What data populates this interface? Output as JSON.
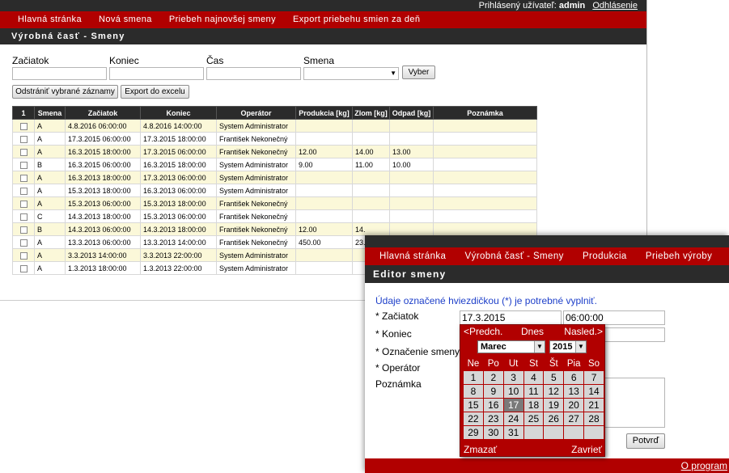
{
  "win1": {
    "user_label": "Prihlásený užívateľ:",
    "user_name": "admin",
    "logout": "Odhlásenie",
    "menu": [
      "Hlavná stránka",
      "Nová smena",
      "Priebeh najnovšej smeny",
      "Export priebehu smien za deň"
    ],
    "title": "Výrobná časť - Smeny",
    "filters": {
      "start_label": "Začiatok",
      "end_label": "Koniec",
      "time_label": "Čas",
      "shift_label": "Smena",
      "select_button": "Vyber"
    },
    "buttons": {
      "delete": "Odstrániť vybrané záznamy",
      "export": "Export do excelu"
    },
    "table": {
      "headers": [
        "1",
        "Smena",
        "Začiatok",
        "Koniec",
        "Operátor",
        "Produkcia [kg]",
        "Zlom [kg]",
        "Odpad [kg]",
        "Poznámka"
      ],
      "rows": [
        [
          "A",
          "4.8.2016 06:00:00",
          "4.8.2016 14:00:00",
          "System Administrator",
          "",
          "",
          "",
          ""
        ],
        [
          "A",
          "17.3.2015 06:00:00",
          "17.3.2015 18:00:00",
          "František Nekonečný",
          "",
          "",
          "",
          ""
        ],
        [
          "A",
          "16.3.2015 18:00:00",
          "17.3.2015 06:00:00",
          "František Nekonečný",
          "12.00",
          "14.00",
          "13.00",
          ""
        ],
        [
          "B",
          "16.3.2015 06:00:00",
          "16.3.2015 18:00:00",
          "System Administrator",
          "9.00",
          "11.00",
          "10.00",
          ""
        ],
        [
          "A",
          "16.3.2013 18:00:00",
          "17.3.2013 06:00:00",
          "System Administrator",
          "",
          "",
          "",
          ""
        ],
        [
          "A",
          "15.3.2013 18:00:00",
          "16.3.2013 06:00:00",
          "System Administrator",
          "",
          "",
          "",
          ""
        ],
        [
          "A",
          "15.3.2013 06:00:00",
          "15.3.2013 18:00:00",
          "František Nekonečný",
          "",
          "",
          "",
          ""
        ],
        [
          "C",
          "14.3.2013 18:00:00",
          "15.3.2013 06:00:00",
          "František Nekonečný",
          "",
          "",
          "",
          ""
        ],
        [
          "B",
          "14.3.2013 06:00:00",
          "14.3.2013 18:00:00",
          "František Nekonečný",
          "12.00",
          "14.",
          "",
          ""
        ],
        [
          "A",
          "13.3.2013 06:00:00",
          "13.3.2013 14:00:00",
          "František Nekonečný",
          "450.00",
          "23.",
          "",
          ""
        ],
        [
          "A",
          "3.3.2013 14:00:00",
          "3.3.2013 22:00:00",
          "System Administrator",
          "",
          "",
          "",
          ""
        ],
        [
          "A",
          "1.3.2013 18:00:00",
          "1.3.2013 22:00:00",
          "System Administrator",
          "",
          "",
          "",
          ""
        ]
      ]
    }
  },
  "win2": {
    "menu": [
      "Hlavná stránka",
      "Výrobná časť - Smeny",
      "Produkcia",
      "Priebeh výroby"
    ],
    "title": "Editor smeny",
    "required_note": "Údaje označené hviezdičkou (*) je potrebné vyplniť.",
    "labels": {
      "start": "* Začiatok",
      "end": "* Koniec",
      "shift": "* Označenie smeny",
      "operator": "* Operátor",
      "note": "Poznámka"
    },
    "start_date_value": "17.3.2015",
    "start_time_value": "06:00:00",
    "confirm_button": "Potvrď",
    "footer_link": "O program"
  },
  "calendar": {
    "prev": "<Predch.",
    "today": "Dnes",
    "next": "Nasled.>",
    "month": "Marec",
    "year": "2015",
    "weekdays": [
      "Ne",
      "Po",
      "Ut",
      "St",
      "Št",
      "Pia",
      "So"
    ],
    "weeks": [
      [
        "1",
        "2",
        "3",
        "4",
        "5",
        "6",
        "7"
      ],
      [
        "8",
        "9",
        "10",
        "11",
        "12",
        "13",
        "14"
      ],
      [
        "15",
        "16",
        "17",
        "18",
        "19",
        "20",
        "21"
      ],
      [
        "22",
        "23",
        "24",
        "25",
        "26",
        "27",
        "28"
      ],
      [
        "29",
        "30",
        "31",
        "",
        "",
        "",
        ""
      ]
    ],
    "selected_day": "17",
    "clear": "Zmazať",
    "close": "Zavrieť"
  }
}
